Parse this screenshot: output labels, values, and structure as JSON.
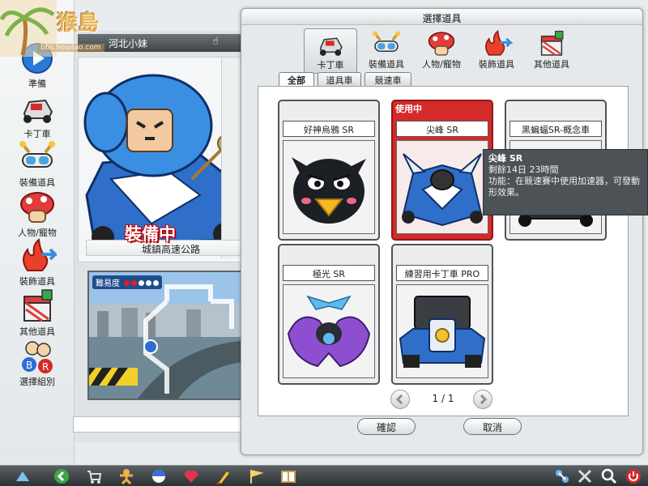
{
  "watermark": {
    "logo_text": "猴島",
    "url": "bbs.houdao.com"
  },
  "sidebar": {
    "items": [
      {
        "label": "準備",
        "icon": "play-icon"
      },
      {
        "label": "卡丁車",
        "icon": "kart-icon"
      },
      {
        "label": "裝備道具",
        "icon": "goggles-icon"
      },
      {
        "label": "人物/寵物",
        "icon": "mushroom-character-icon"
      },
      {
        "label": "裝飾道具",
        "icon": "flame-arrow-icon"
      },
      {
        "label": "其他道具",
        "icon": "gift-box-icon"
      },
      {
        "label": "選擇組別",
        "icon": "team-select-icon"
      }
    ]
  },
  "lobby": {
    "player_name": "河北小妹",
    "equipped_badge": "裝備中",
    "track_name": "城鎮高速公路",
    "difficulty_label": "難易度",
    "difficulty": {
      "filled": 2,
      "total": 5
    },
    "colors": {
      "difficulty_filled": "#e02020",
      "difficulty_empty": "#ffffff"
    }
  },
  "dialog": {
    "title": "選擇道具",
    "categories": [
      {
        "label": "卡丁車",
        "icon": "kart-icon",
        "active": true
      },
      {
        "label": "裝備道具",
        "icon": "goggles-icon",
        "active": false
      },
      {
        "label": "人物/寵物",
        "icon": "mushroom-character-icon",
        "active": false
      },
      {
        "label": "裝飾道具",
        "icon": "flame-arrow-icon",
        "active": false
      },
      {
        "label": "其他道具",
        "icon": "gift-box-icon",
        "active": false
      }
    ],
    "subtabs": [
      {
        "label": "全部",
        "active": true
      },
      {
        "label": "道具車",
        "active": false
      },
      {
        "label": "競速車",
        "active": false
      }
    ],
    "items": [
      {
        "name": "好神烏鴉 SR",
        "art": "crow-kart",
        "in_use": false
      },
      {
        "name": "尖峰 SR",
        "art": "peak-kart",
        "in_use": true,
        "tag": "使用中"
      },
      {
        "name": "黑蝙蝠SR-概念車",
        "art": "bat-kart",
        "in_use": false
      },
      {
        "name": "極光 SR",
        "art": "aurora-kart",
        "in_use": false
      },
      {
        "name": "練習用卡丁車 PRO",
        "art": "practice-kart",
        "in_use": false
      }
    ],
    "pager": {
      "text": "1 / 1"
    },
    "confirm_label": "確認",
    "cancel_label": "取消"
  },
  "tooltip": {
    "name": "尖峰 SR",
    "remaining": "剩餘14日 23時間",
    "function_line1": "功能：在競速賽中使用加速器，可發動",
    "function_line2": "形效果。"
  },
  "taskbar": {
    "icons": [
      "game-logo-icon",
      "back-arrow-icon",
      "shop-cart-icon",
      "character-pose-icon",
      "capsule-icon",
      "heart-icon",
      "brush-icon",
      "flag-icon",
      "book-icon",
      "network-icon",
      "tools-icon",
      "search-icon",
      "power-icon"
    ]
  },
  "colors": {
    "in_use_card": "#d42a2a",
    "tooltip_bg": "#4c5256",
    "kart_blue": "#2f6fc9"
  }
}
